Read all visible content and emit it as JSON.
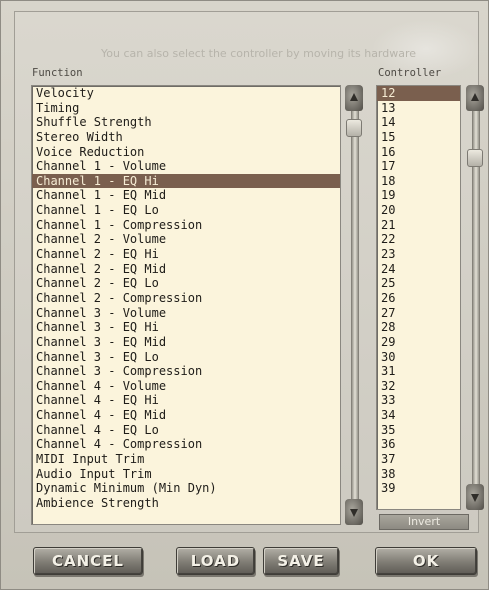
{
  "hint_text": "You can also select the controller by moving its hardware",
  "labels": {
    "function": "Function",
    "controller": "Controller"
  },
  "functions": [
    "Velocity",
    "Timing",
    "Shuffle Strength",
    "Stereo Width",
    "Voice Reduction",
    "Channel 1 - Volume",
    "Channel 1 - EQ Hi",
    "Channel 1 - EQ Mid",
    "Channel 1 - EQ Lo",
    "Channel 1 - Compression",
    "Channel 2 - Volume",
    "Channel 2 - EQ Hi",
    "Channel 2 - EQ Mid",
    "Channel 2 - EQ Lo",
    "Channel 2 - Compression",
    "Channel 3 - Volume",
    "Channel 3 - EQ Hi",
    "Channel 3 - EQ Mid",
    "Channel 3 - EQ Lo",
    "Channel 3 - Compression",
    "Channel 4 - Volume",
    "Channel 4 - EQ Hi",
    "Channel 4 - EQ Mid",
    "Channel 4 - EQ Lo",
    "Channel 4 - Compression",
    "MIDI Input Trim",
    "Audio Input Trim",
    "Dynamic Minimum (Min Dyn)",
    "Ambience Strength"
  ],
  "selected_function_index": 6,
  "controllers": [
    "12",
    "13",
    "14",
    "15",
    "16",
    "17",
    "18",
    "19",
    "20",
    "21",
    "22",
    "23",
    "24",
    "25",
    "26",
    "27",
    "28",
    "29",
    "30",
    "31",
    "32",
    "33",
    "34",
    "35",
    "36",
    "37",
    "38",
    "39"
  ],
  "selected_controller_index": 0,
  "buttons": {
    "invert": "Invert",
    "cancel": "CANCEL",
    "load": "LOAD",
    "save": "SAVE",
    "ok": "OK"
  },
  "icons": {
    "scroll_up": "up-arrow-icon",
    "scroll_down": "down-arrow-icon"
  },
  "colors": {
    "list_background": "#fbf4dc",
    "selection": "#7a5f4e"
  }
}
